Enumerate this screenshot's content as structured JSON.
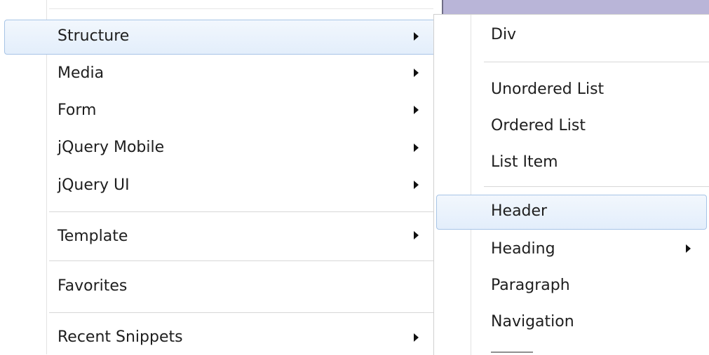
{
  "left_menu": {
    "items": [
      {
        "label": "Structure"
      },
      {
        "label": "Media"
      },
      {
        "label": "Form"
      },
      {
        "label": "jQuery Mobile"
      },
      {
        "label": "jQuery UI"
      },
      {
        "label": "Template"
      },
      {
        "label": "Favorites"
      },
      {
        "label": "Recent Snippets"
      }
    ]
  },
  "submenu": {
    "items": [
      {
        "label": "Div"
      },
      {
        "label": "Unordered List"
      },
      {
        "label": "Ordered List"
      },
      {
        "label": "List Item"
      },
      {
        "label": "Header"
      },
      {
        "label": "Heading"
      },
      {
        "label": "Paragraph"
      },
      {
        "label": "Navigation"
      }
    ]
  },
  "colors": {
    "highlight_border": "#a7c4e6",
    "highlight_fill": "#e3eefb",
    "separator": "#d7d7d7",
    "window_strip": "#b9b5d8"
  }
}
